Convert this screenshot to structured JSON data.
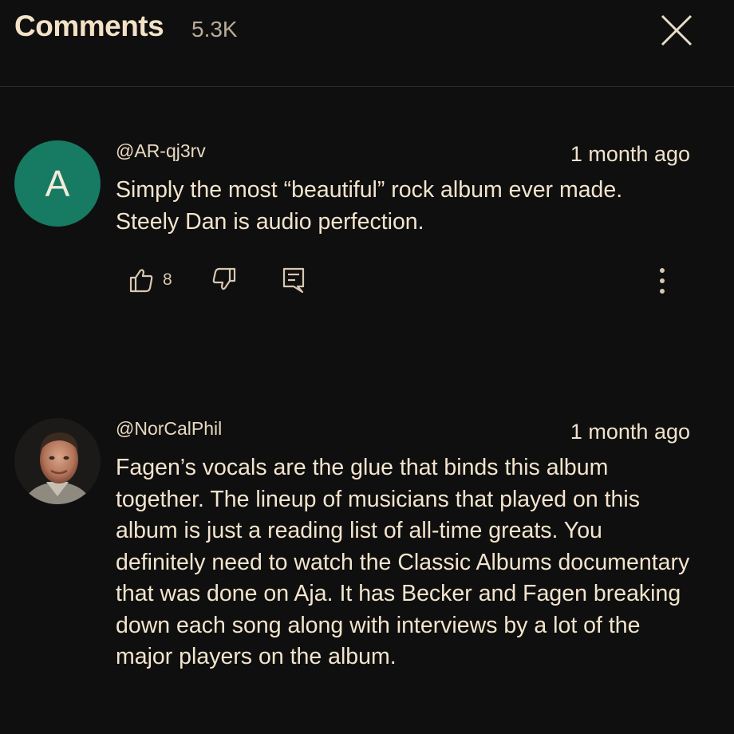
{
  "header": {
    "title": "Comments",
    "count": "5.3K",
    "close_icon": "close-icon"
  },
  "comments": [
    {
      "avatar_letter": "A",
      "avatar_color": "#177a63",
      "handle": "@AR-qj3rv",
      "time": "1 month ago",
      "text": "Simply the most “beautiful” rock album ever made. Steely Dan is audio perfection.",
      "likes": "8",
      "icons": [
        "thumbs-up-icon",
        "thumbs-down-icon",
        "reply-icon",
        "more-vert-icon"
      ]
    },
    {
      "avatar_photo": true,
      "handle": "@NorCalPhil",
      "time": "1 month ago",
      "text": "Fagen’s vocals are the glue that binds this album together. The lineup of musicians that played on this album is just a reading list of all-time greats. You definitely need to watch the Classic Albums documentary that was done on Aja. It has Becker and Fagen breaking down each song along with interviews by a lot of the major players on the album."
    }
  ]
}
